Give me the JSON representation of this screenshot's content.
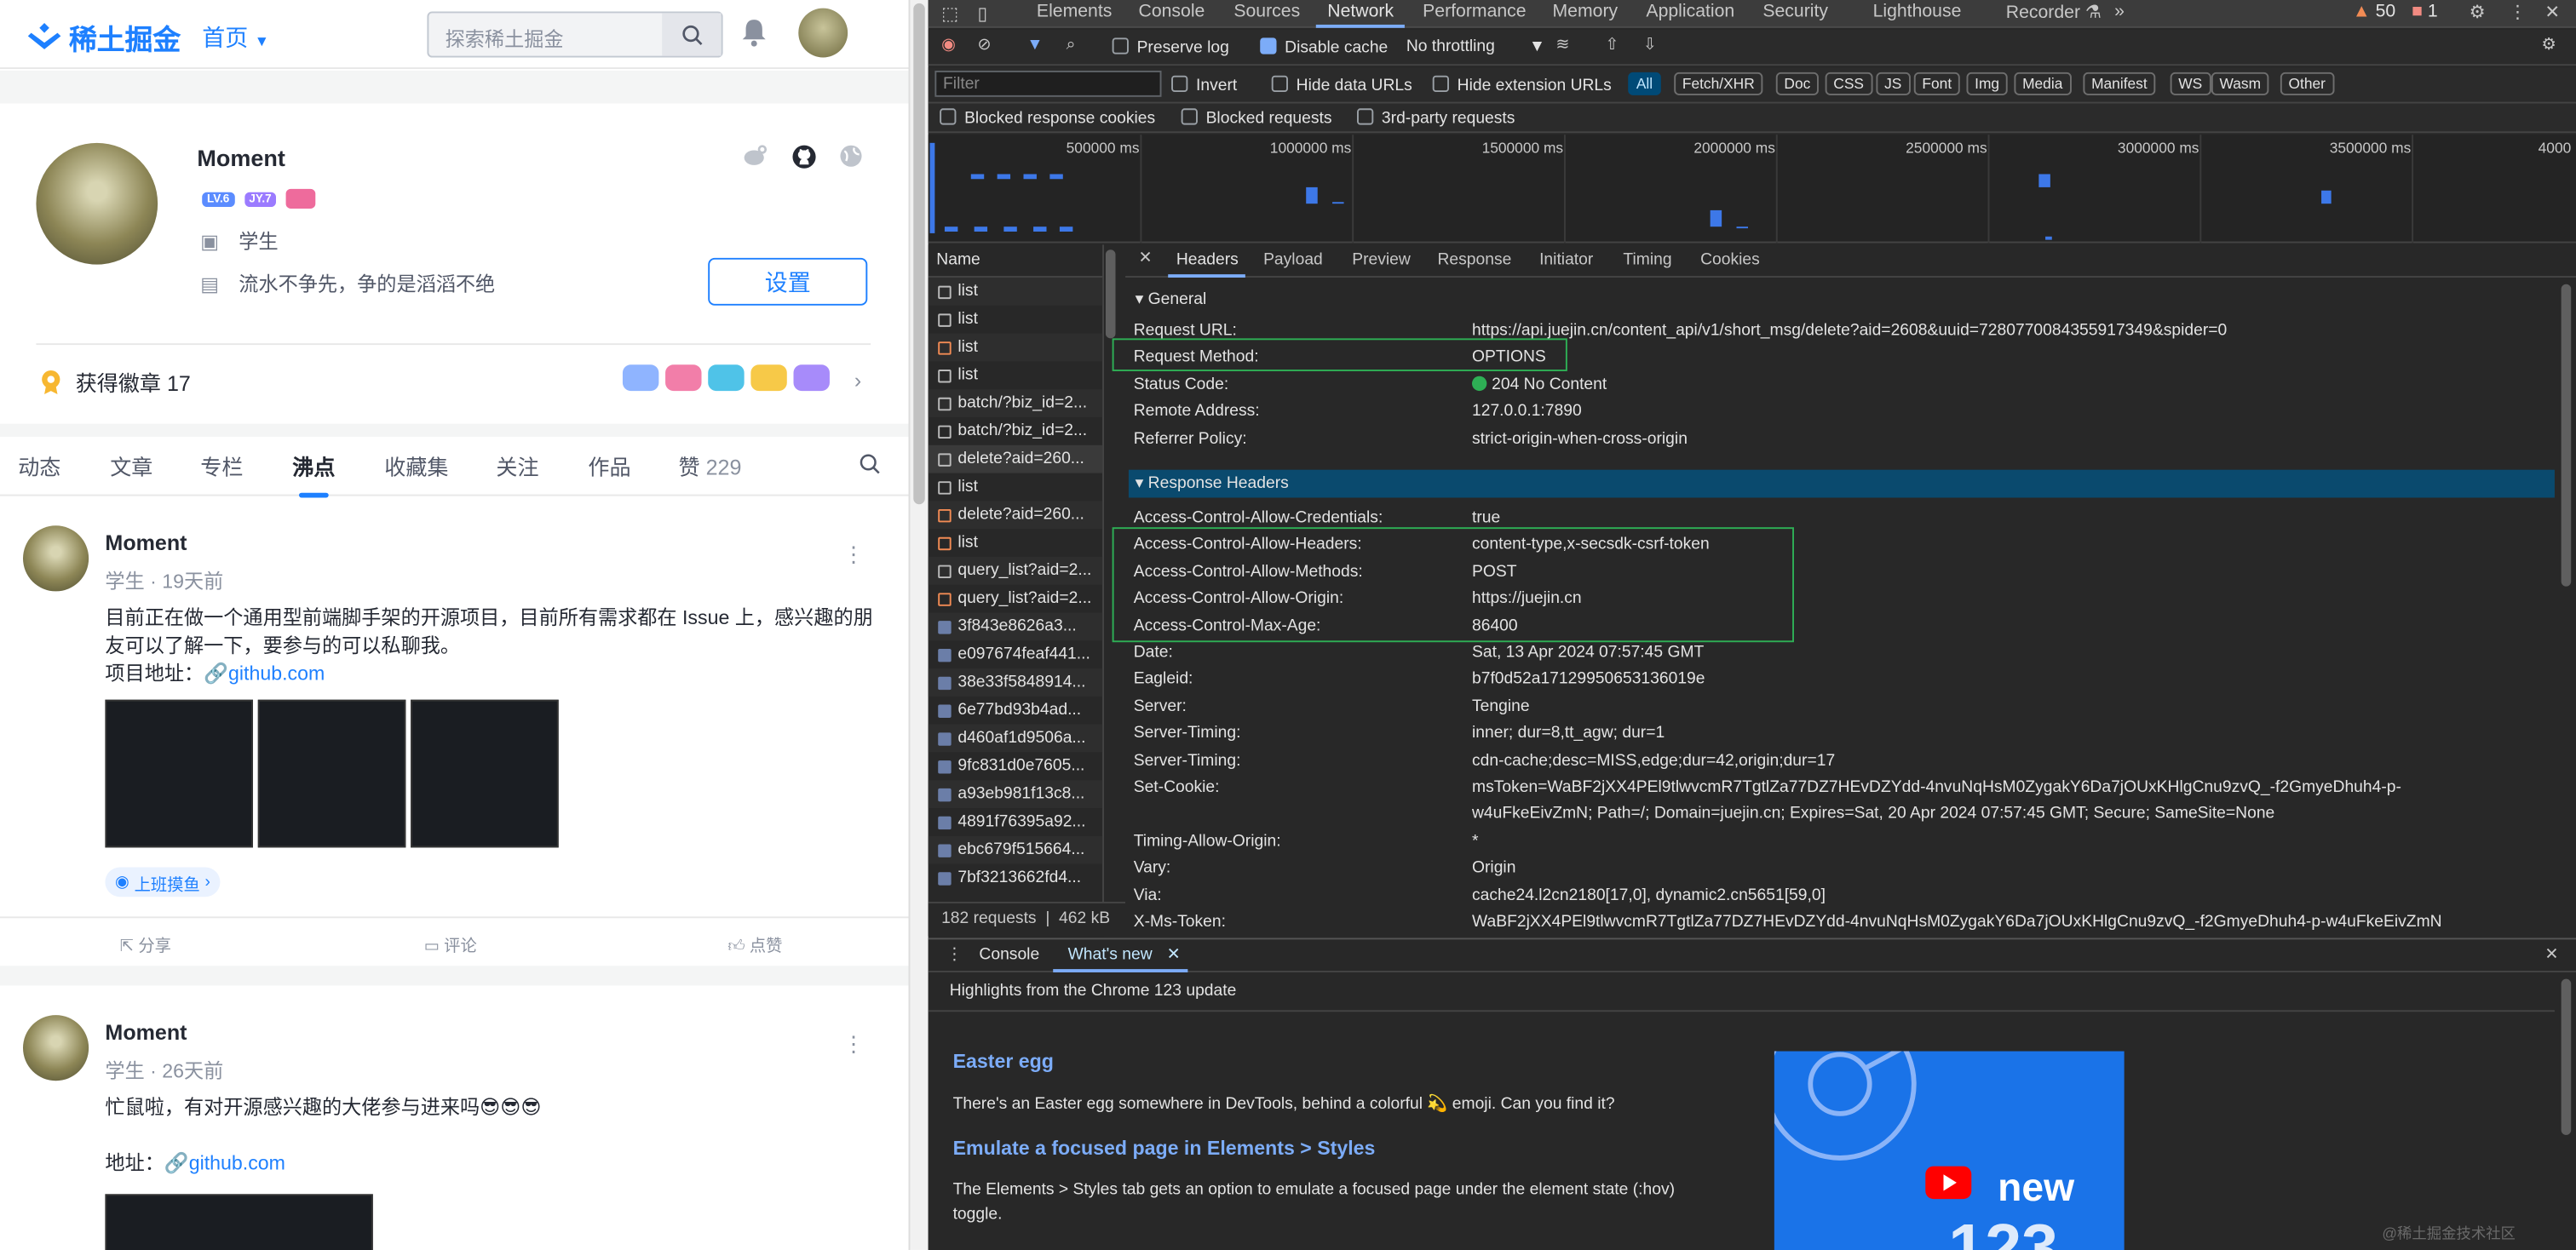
{
  "left": {
    "logo": "稀土掘金",
    "nav_home": "首页",
    "search_placeholder": "探索稀土掘金",
    "profile": {
      "name": "Moment",
      "lv": "LV.6",
      "jy": "JY.7",
      "job": "学生",
      "motto": "流水不争先，争的是滔滔不绝",
      "settings": "设置",
      "medals": "获得徽章 17"
    },
    "tabs": [
      "动态",
      "文章",
      "专栏",
      "沸点",
      "收藏集",
      "关注",
      "作品",
      "赞"
    ],
    "likes_count": "229",
    "posts": [
      {
        "name": "Moment",
        "meta": "学生 · 19天前",
        "text": "目前正在做一个通用型前端脚手架的开源项目，目前所有需求都在 Issue 上，感兴趣的朋友可以了解一下，要参与的可以私聊我。",
        "addr_label": "项目地址：",
        "link": "github.com",
        "tag": "上班摸鱼",
        "share": "分享",
        "comment": "评论",
        "like": "点赞"
      },
      {
        "name": "Moment",
        "meta": "学生 · 26天前",
        "text": "忙鼠啦，有对开源感兴趣的大佬参与进来吗😎😎😎",
        "addr_label": "地址：",
        "link": "github.com"
      }
    ]
  },
  "devtools": {
    "tabs": [
      "Elements",
      "Console",
      "Sources",
      "Network",
      "Performance",
      "Memory",
      "Application",
      "Security",
      "Lighthouse",
      "Recorder ⚗"
    ],
    "warnings": "50",
    "errors": "1",
    "preserve_log": "Preserve log",
    "disable_cache": "Disable cache",
    "throttling": "No throttling",
    "filter_placeholder": "Filter",
    "invert": "Invert",
    "hide_data": "Hide data URLs",
    "hide_ext": "Hide extension URLs",
    "types": [
      "All",
      "Fetch/XHR",
      "Doc",
      "CSS",
      "JS",
      "Font",
      "Img",
      "Media",
      "Manifest",
      "WS",
      "Wasm",
      "Other"
    ],
    "blocked_cookies": "Blocked response cookies",
    "blocked_requests": "Blocked requests",
    "third_party": "3rd-party requests",
    "timeline_labels": [
      "500000 ms",
      "1000000 ms",
      "1500000 ms",
      "2000000 ms",
      "2500000 ms",
      "3000000 ms",
      "3500000 ms",
      "4000"
    ],
    "name_header": "Name",
    "requests": [
      {
        "name": "list",
        "icon": "doc"
      },
      {
        "name": "list",
        "icon": "doc"
      },
      {
        "name": "list",
        "icon": "xhr"
      },
      {
        "name": "list",
        "icon": "doc"
      },
      {
        "name": "batch/?biz_id=2...",
        "icon": "doc"
      },
      {
        "name": "batch/?biz_id=2...",
        "icon": "doc"
      },
      {
        "name": "delete?aid=260...",
        "icon": "doc"
      },
      {
        "name": "list",
        "icon": "doc"
      },
      {
        "name": "delete?aid=260...",
        "icon": "xhr"
      },
      {
        "name": "list",
        "icon": "xhr"
      },
      {
        "name": "query_list?aid=2...",
        "icon": "doc"
      },
      {
        "name": "query_list?aid=2...",
        "icon": "xhr"
      },
      {
        "name": "3f843e8626a3...",
        "icon": "img"
      },
      {
        "name": "e097674feaf441...",
        "icon": "img"
      },
      {
        "name": "38e33f5848914...",
        "icon": "img"
      },
      {
        "name": "6e77bd93b4ad...",
        "icon": "img"
      },
      {
        "name": "d460af1d9506a...",
        "icon": "img"
      },
      {
        "name": "9fc831d0e7605...",
        "icon": "img"
      },
      {
        "name": "a93eb981f13c8...",
        "icon": "img"
      },
      {
        "name": "4891f76395a92...",
        "icon": "img"
      },
      {
        "name": "ebc679f515664...",
        "icon": "img"
      },
      {
        "name": "7bf3213662fd4...",
        "icon": "img"
      }
    ],
    "status_requests": "182 requests",
    "status_size": "462 kB",
    "detail_tabs": [
      "Headers",
      "Payload",
      "Preview",
      "Response",
      "Initiator",
      "Timing",
      "Cookies"
    ],
    "general_title": "▾ General",
    "general": [
      {
        "k": "Request URL:",
        "v": "https://api.juejin.cn/content_api/v1/short_msg/delete?aid=2608&uuid=7280770084355917349&spider=0"
      },
      {
        "k": "Request Method:",
        "v": "OPTIONS"
      },
      {
        "k": "Status Code:",
        "v": "204 No Content"
      },
      {
        "k": "Remote Address:",
        "v": "127.0.0.1:7890"
      },
      {
        "k": "Referrer Policy:",
        "v": "strict-origin-when-cross-origin"
      }
    ],
    "response_title": "▾ Response Headers",
    "response": [
      {
        "k": "Access-Control-Allow-Credentials:",
        "v": "true"
      },
      {
        "k": "Access-Control-Allow-Headers:",
        "v": "content-type,x-secsdk-csrf-token"
      },
      {
        "k": "Access-Control-Allow-Methods:",
        "v": "POST"
      },
      {
        "k": "Access-Control-Allow-Origin:",
        "v": "https://juejin.cn"
      },
      {
        "k": "Access-Control-Max-Age:",
        "v": "86400"
      },
      {
        "k": "Date:",
        "v": "Sat, 13 Apr 2024 07:57:45 GMT"
      },
      {
        "k": "Eagleid:",
        "v": "b7f0d52a17129950653136019e"
      },
      {
        "k": "Server:",
        "v": "Tengine"
      },
      {
        "k": "Server-Timing:",
        "v": "inner; dur=8,tt_agw; dur=1"
      },
      {
        "k": "Server-Timing:",
        "v": "cdn-cache;desc=MISS,edge;dur=42,origin;dur=17"
      },
      {
        "k": "Set-Cookie:",
        "v": "msToken=WaBF2jXX4PEl9tlwvcmR7TgtlZa77DZ7HEvDZYdd-4nvuNqHsM0ZygakY6Da7jOUxKHlgCnu9zvQ_-f2GmyeDhuh4-p-"
      },
      {
        "k": "",
        "v": "w4uFkeEivZmN; Path=/; Domain=juejin.cn; Expires=Sat, 20 Apr 2024 07:57:45 GMT; Secure; SameSite=None"
      },
      {
        "k": "Timing-Allow-Origin:",
        "v": "*"
      },
      {
        "k": "Vary:",
        "v": "Origin"
      },
      {
        "k": "Via:",
        "v": "cache24.l2cn2180[17,0], dynamic2.cn5651[59,0]"
      },
      {
        "k": "X-Ms-Token:",
        "v": "WaBF2jXX4PEl9tlwvcmR7TgtlZa77DZ7HEvDZYdd-4nvuNqHsM0ZygakY6Da7jOUxKHlgCnu9zvQ_-f2GmyeDhuh4-p-w4uFkeEivZmN"
      }
    ],
    "drawer_tabs": [
      "Console",
      "What's new"
    ],
    "wn_title": "Highlights from the Chrome 123 update",
    "wn1_h": "Easter egg",
    "wn1_p": "There's an Easter egg somewhere in DevTools, behind a colorful 💫 emoji. Can you find it?",
    "wn2_h": "Emulate a focused page in Elements > Styles",
    "wn2_p": "The Elements > Styles tab gets an option to emulate a focused page under the element state (:hov) toggle.",
    "video_text": "new",
    "video_num": "123",
    "watermark": "@稀土掘金技术社区"
  }
}
